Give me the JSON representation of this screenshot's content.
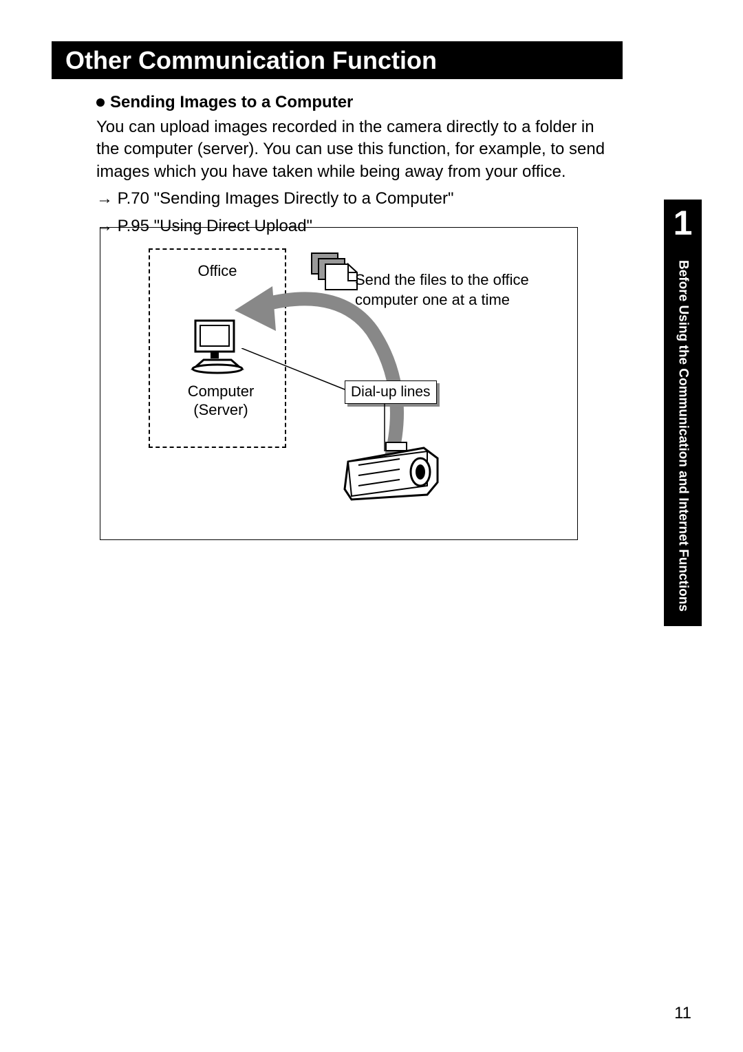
{
  "header": {
    "title": "Other Communication Function"
  },
  "section": {
    "bullet_title": "Sending Images to a Computer",
    "body": "You can upload images recorded in the camera directly to a folder in the computer (server). You can use this function, for example, to send images which you have taken while being away from your office.",
    "refs": [
      {
        "arrow": "→",
        "text": "P.70 \"Sending Images Directly to a Computer\""
      },
      {
        "arrow": "→",
        "text": "P.95 \"Using Direct Upload\""
      }
    ]
  },
  "diagram": {
    "office_label": "Office",
    "computer_label": "Computer",
    "server_label": "(Server)",
    "dialup_label": "Dial-up lines",
    "caption": "Send the files to the office computer one at a time"
  },
  "sidebar": {
    "chapter_number": "1",
    "chapter_title": "Before Using the Communication and Internet Functions"
  },
  "page_number": "11"
}
